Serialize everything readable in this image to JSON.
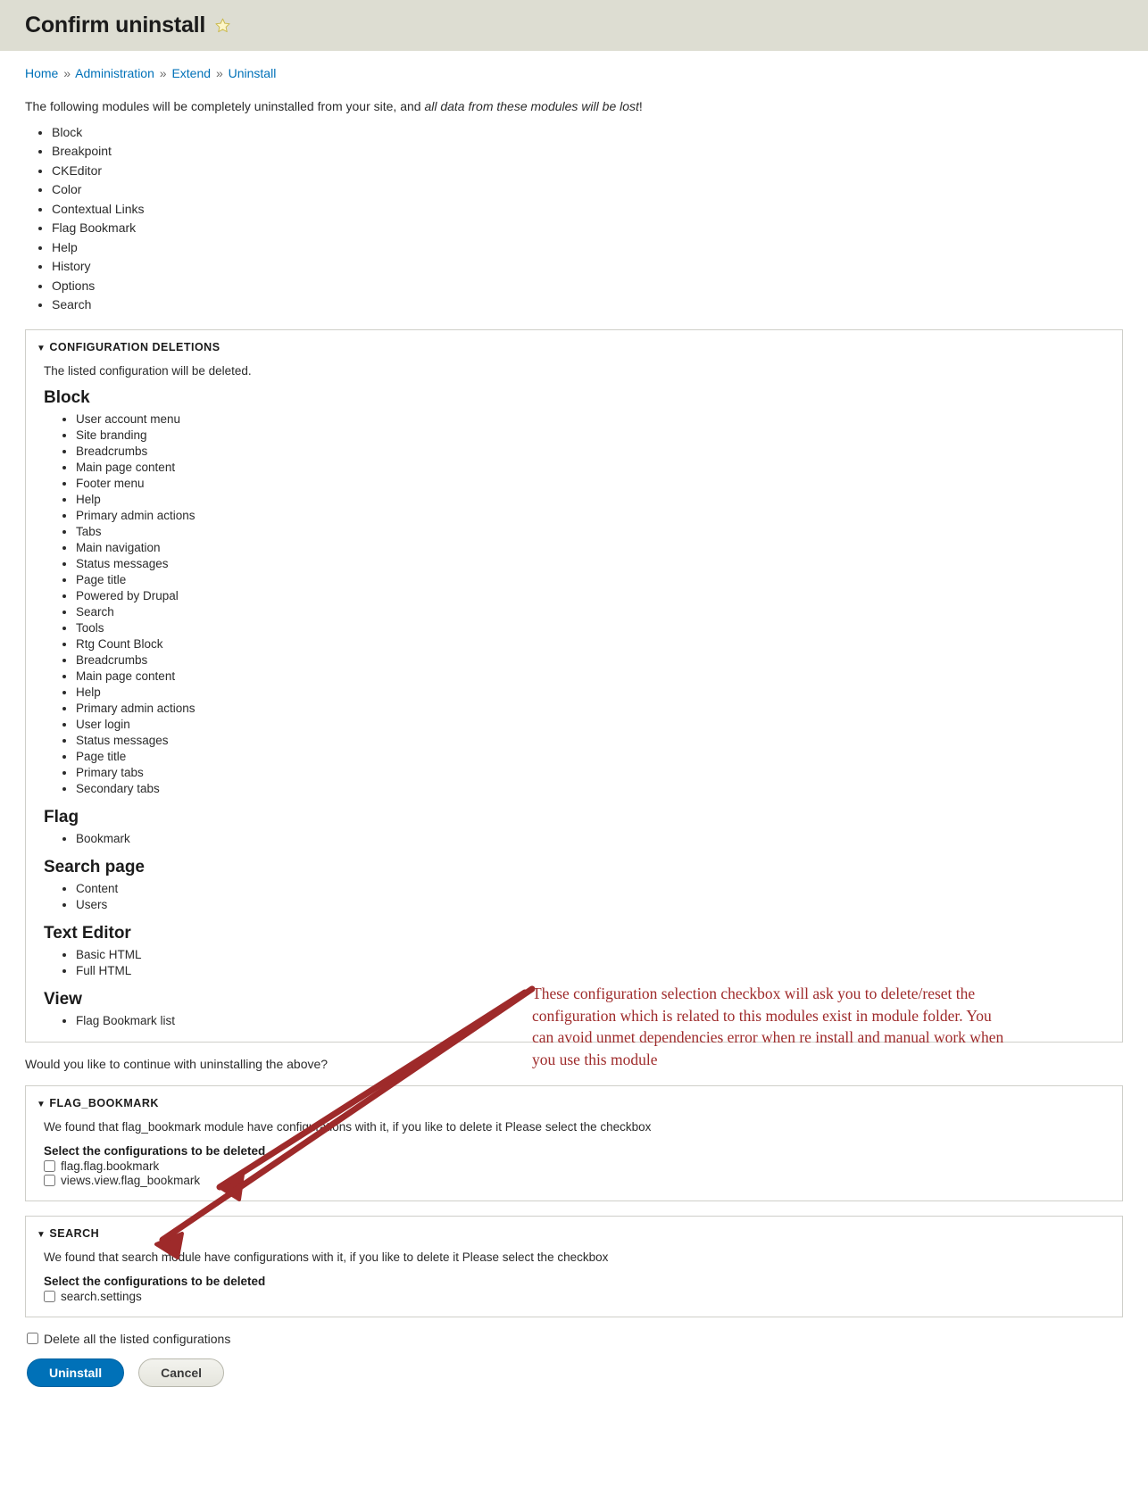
{
  "header": {
    "title": "Confirm uninstall",
    "star_icon": "star-icon"
  },
  "breadcrumb": {
    "items": [
      {
        "label": "Home"
      },
      {
        "label": "Administration"
      },
      {
        "label": "Extend"
      },
      {
        "label": "Uninstall"
      }
    ],
    "separator": "»"
  },
  "intro": {
    "text_before": "The following modules will be completely uninstalled from your site, and ",
    "emphasis": "all data from these modules will be lost",
    "text_after": "!",
    "modules": [
      "Block",
      "Breakpoint",
      "CKEditor",
      "Color",
      "Contextual Links",
      "Flag Bookmark",
      "Help",
      "History",
      "Options",
      "Search"
    ]
  },
  "config_deletions": {
    "summary": "CONFIGURATION DELETIONS",
    "triangle": "▼",
    "description": "The listed configuration will be deleted.",
    "groups": [
      {
        "title": "Block",
        "items": [
          "User account menu",
          "Site branding",
          "Breadcrumbs",
          "Main page content",
          "Footer menu",
          "Help",
          "Primary admin actions",
          "Tabs",
          "Main navigation",
          "Status messages",
          "Page title",
          "Powered by Drupal",
          "Search",
          "Tools",
          "Rtg Count Block",
          "Breadcrumbs",
          "Main page content",
          "Help",
          "Primary admin actions",
          "User login",
          "Status messages",
          "Page title",
          "Primary tabs",
          "Secondary tabs"
        ]
      },
      {
        "title": "Flag",
        "items": [
          "Bookmark"
        ]
      },
      {
        "title": "Search page",
        "items": [
          "Content",
          "Users"
        ]
      },
      {
        "title": "Text Editor",
        "items": [
          "Basic HTML",
          "Full HTML"
        ]
      },
      {
        "title": "View",
        "items": [
          "Flag Bookmark list"
        ]
      }
    ]
  },
  "continue_question": "Would you like to continue with uninstalling the above?",
  "module_sections": [
    {
      "summary": "FLAG_BOOKMARK",
      "triangle": "▼",
      "description": "We found that flag_bookmark module have configurations with it, if you like to delete it Please select the checkbox",
      "group_label": "Select the configurations to be deleted",
      "checkboxes": [
        {
          "label": "flag.flag.bookmark",
          "checked": false
        },
        {
          "label": "views.view.flag_bookmark",
          "checked": false
        }
      ]
    },
    {
      "summary": "SEARCH",
      "triangle": "▼",
      "description": "We found that search module have configurations with it, if you like to delete it Please select the checkbox",
      "group_label": "Select the configurations to be deleted",
      "checkboxes": [
        {
          "label": "search.settings",
          "checked": false
        }
      ]
    }
  ],
  "delete_all": {
    "label": "Delete all the listed configurations",
    "checked": false
  },
  "actions": {
    "uninstall_label": "Uninstall",
    "cancel_label": "Cancel"
  },
  "annotation": {
    "text": "These configuration selection checkbox will ask you to delete/reset the configuration which is related to this modules exist in module folder. You can avoid unmet dependencies error when re install and manual work when you use this module",
    "color": "#9e2a2a"
  },
  "colors": {
    "header_bg": "#ddddd2",
    "link": "#0071b8",
    "primary_button": "#0071b8",
    "annotation": "#9e2a2a"
  }
}
